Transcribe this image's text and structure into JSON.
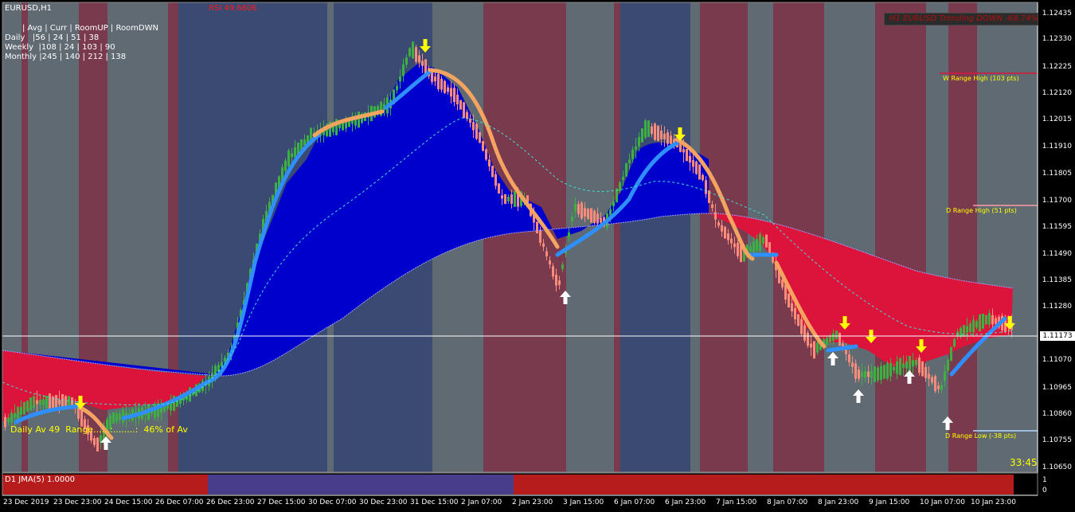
{
  "window": {
    "symbol_title": "EURUSD,H1"
  },
  "indicators": {
    "rsi_text": "RSI 49.6606",
    "trend_text": "H1 EURUSD Trending DOWN -68.74%",
    "range_table": {
      "header": "| Avg | Curr | RoomUP | RoomDWN",
      "rows": [
        "Daily   |56 | 24 | 51 | 38",
        "Weekly  |108 | 24 | 103 | 90",
        "Monthly |245 | 140 | 212 | 138"
      ]
    },
    "daily_av_text": "Daily Av 49  Range......:........:  46% of Av",
    "countdown": "33:45",
    "levels": {
      "w_range_high": "W Range High (103 pts)",
      "d_range_high": "D Range High (51 pts)",
      "d_range_low": "D Range Low (-38 pts)"
    },
    "current_price": "1.11173",
    "subwindow_label": "D1 JMA(5) 1.0000",
    "subwindow_scale": [
      "1",
      "0"
    ]
  },
  "price_axis": [
    "1.12435",
    "1.12330",
    "1.12225",
    "1.12120",
    "1.12015",
    "1.11910",
    "1.11805",
    "1.11700",
    "1.11595",
    "1.11490",
    "1.11385",
    "1.11280",
    "1.11070",
    "1.10965",
    "1.10860",
    "1.10755",
    "1.10650"
  ],
  "time_axis": [
    "23 Dec 2019",
    "23 Dec 23:00",
    "24 Dec 15:00",
    "26 Dec 07:00",
    "26 Dec 23:00",
    "27 Dec 15:00",
    "30 Dec 07:00",
    "30 Dec 23:00",
    "31 Dec 15:00",
    "2 Jan 07:00",
    "2 Jan 23:00",
    "3 Jan 15:00",
    "6 Jan 07:00",
    "6 Jan 23:00",
    "7 Jan 15:00",
    "8 Jan 07:00",
    "8 Jan 23:00",
    "9 Jan 15:00",
    "10 Jan 07:00",
    "10 Jan 23:00"
  ],
  "colors": {
    "background": "#000000",
    "bear_stripe": "#7a3a4e",
    "neutral_stripe": "#5f6a72",
    "bull_stripe": "#3b4a72",
    "blue_cloud": "#0000cc",
    "red_cloud": "#dc143c",
    "bull_candle": "#3cb043",
    "bear_candle": "#ff8c7a",
    "up_arrow": "#ffffff",
    "down_arrow": "#ffff00"
  }
}
